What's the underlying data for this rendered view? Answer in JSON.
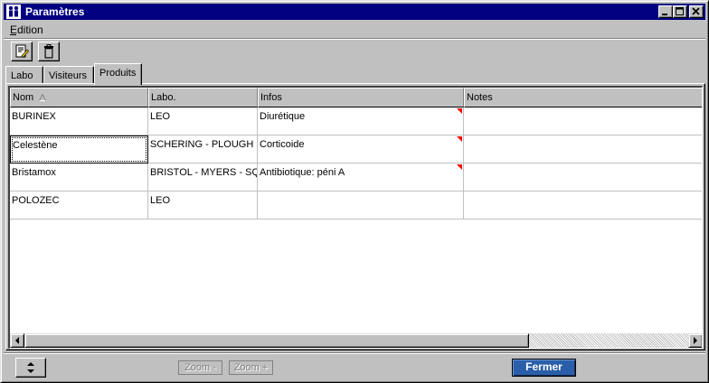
{
  "window": {
    "title": "Paramètres",
    "app_icon": "people-icon",
    "controls": [
      "minimize-icon",
      "maximize-icon",
      "close-icon"
    ]
  },
  "menu": {
    "items": [
      {
        "label": "Edition"
      }
    ]
  },
  "toolbar": {
    "buttons": [
      {
        "icon": "edit-document-icon"
      },
      {
        "icon": "trash-icon"
      }
    ]
  },
  "tabs": [
    {
      "label": "Labo",
      "active": false
    },
    {
      "label": "Visiteurs",
      "active": false
    },
    {
      "label": "Produits",
      "active": true
    }
  ],
  "grid": {
    "columns": [
      {
        "label": "Nom",
        "sorted": "ascending"
      },
      {
        "label": "Labo."
      },
      {
        "label": "Infos"
      },
      {
        "label": "Notes"
      }
    ],
    "rows": [
      {
        "nom": "BURINEX",
        "labo": "LEO",
        "infos": "Diurétique",
        "notes": "",
        "flag": true
      },
      {
        "nom": "Celestène",
        "labo": "SCHERING - PLOUGH",
        "infos": "Corticoide",
        "notes": "",
        "flag": true
      },
      {
        "nom": "Bristamox",
        "labo": "BRISTOL - MYERS - SQUIBB",
        "infos": "Antibiotique: péni A",
        "notes": "",
        "flag": true
      },
      {
        "nom": "POLOZEC",
        "labo": "LEO",
        "infos": "",
        "notes": "",
        "flag": false
      }
    ]
  },
  "footer": {
    "zoom_out_label": "Zoom -",
    "zoom_in_label": "Zoom +",
    "close_label": "Fermer"
  },
  "colors": {
    "titlebar": "#000080",
    "flag": "#ff0000",
    "primary_button": "#2a5ea8"
  }
}
